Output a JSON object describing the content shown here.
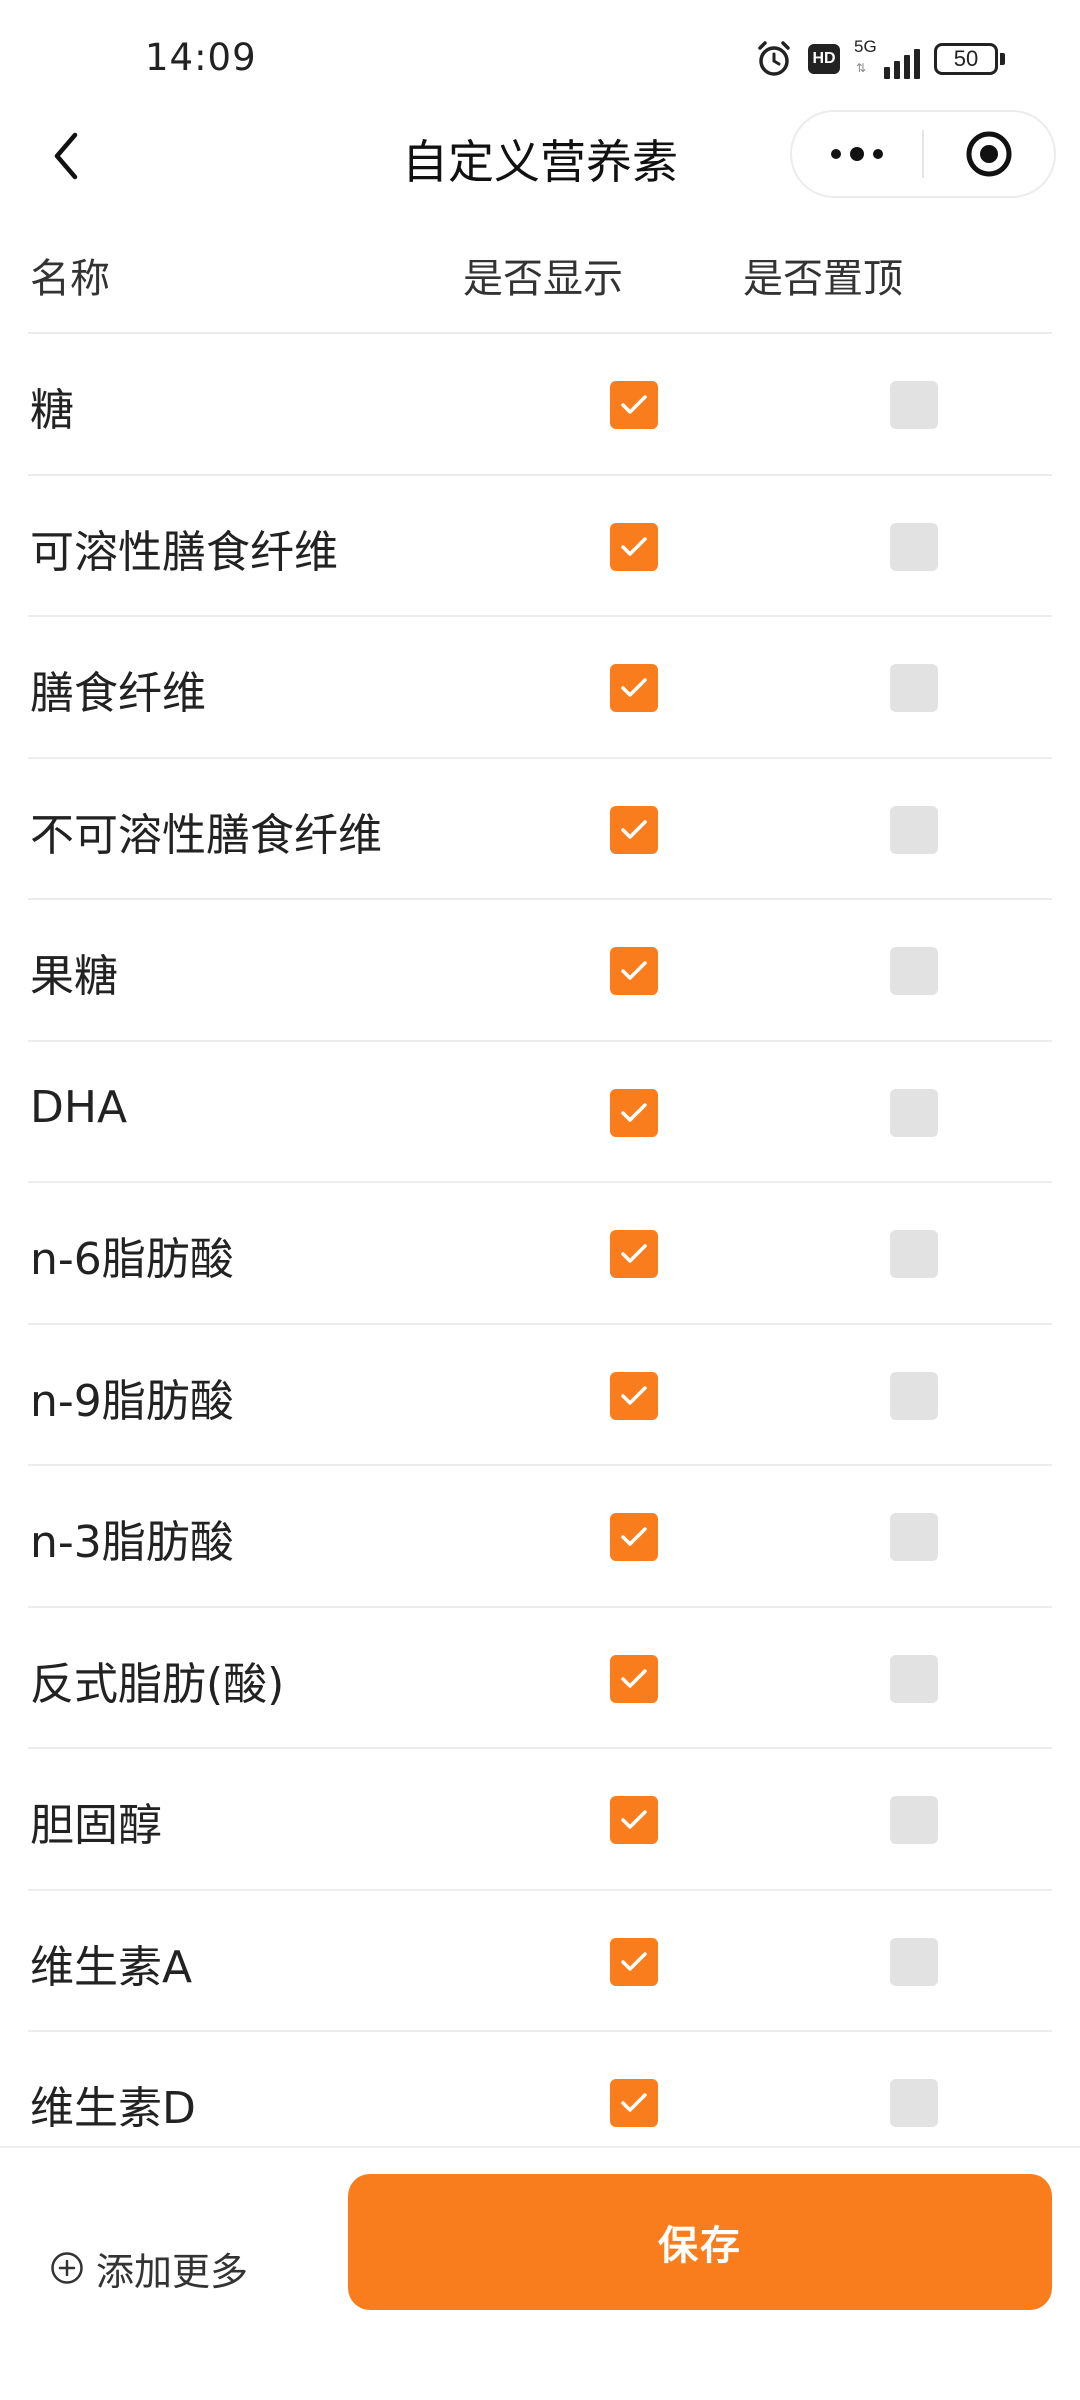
{
  "status_bar": {
    "time": "14:09",
    "network": "5G",
    "hd": "HD",
    "battery": "50"
  },
  "nav": {
    "title": "自定义营养素",
    "icons": [
      "back-chevron-icon",
      "more-dots-icon",
      "close-target-icon"
    ]
  },
  "table": {
    "headers": {
      "name": "名称",
      "show": "是否显示",
      "pin": "是否置顶"
    },
    "rows": [
      {
        "name": "糖",
        "show": true,
        "pin": false
      },
      {
        "name": "可溶性膳食纤维",
        "show": true,
        "pin": false
      },
      {
        "name": "膳食纤维",
        "show": true,
        "pin": false
      },
      {
        "name": "不可溶性膳食纤维",
        "show": true,
        "pin": false
      },
      {
        "name": "果糖",
        "show": true,
        "pin": false
      },
      {
        "name": "DHA",
        "show": true,
        "pin": false
      },
      {
        "name": "n-6脂肪酸",
        "show": true,
        "pin": false
      },
      {
        "name": "n-9脂肪酸",
        "show": true,
        "pin": false
      },
      {
        "name": "n-3脂肪酸",
        "show": true,
        "pin": false
      },
      {
        "name": "反式脂肪(酸)",
        "show": true,
        "pin": false
      },
      {
        "name": "胆固醇",
        "show": true,
        "pin": false
      },
      {
        "name": "维生素A",
        "show": true,
        "pin": false
      },
      {
        "name": "维生素D",
        "show": true,
        "pin": false
      }
    ]
  },
  "bottom": {
    "add_more": "添加更多",
    "save": "保存"
  },
  "colors": {
    "accent": "#fa7d1d",
    "checkbox_off": "#e2e2e2",
    "divider": "#ececec"
  }
}
